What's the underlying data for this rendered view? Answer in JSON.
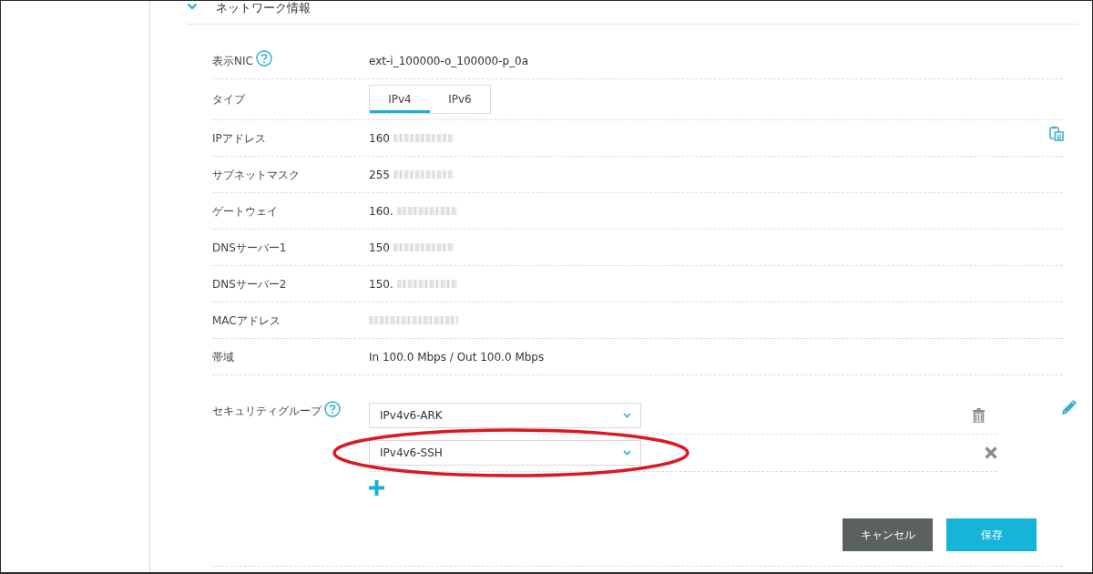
{
  "section": {
    "title": "ネットワーク情報",
    "expanded": true
  },
  "network_info": {
    "rows": [
      {
        "kind": "text",
        "label": "表示NIC",
        "help": true,
        "value": "ext-i_100000-o_100000-p_0a",
        "blurred": false
      },
      {
        "kind": "tabs",
        "label": "タイプ",
        "help": false,
        "tabs": [
          {
            "label": "IPv4",
            "selected": true
          },
          {
            "label": "IPv6",
            "selected": false
          }
        ]
      },
      {
        "kind": "text",
        "label": "IPアドレス",
        "help": false,
        "value": "160",
        "blurred": true
      },
      {
        "kind": "text",
        "label": "サブネットマスク",
        "help": false,
        "value": "255",
        "blurred": true
      },
      {
        "kind": "text",
        "label": "ゲートウェイ",
        "help": false,
        "value": "160.",
        "blurred": true
      },
      {
        "kind": "text",
        "label": "DNSサーバー1",
        "help": false,
        "value": "150",
        "blurred": true
      },
      {
        "kind": "text",
        "label": "DNSサーバー2",
        "help": false,
        "value": "150.",
        "blurred": true
      },
      {
        "kind": "text",
        "label": "MACアドレス",
        "help": false,
        "blurred": true
      },
      {
        "kind": "text",
        "label": "帯域",
        "help": false,
        "value": "In 100.0 Mbps / Out 100.0 Mbps",
        "blurred": false
      }
    ]
  },
  "security_group": {
    "label": "セキュリティグループ",
    "help": true,
    "items": [
      {
        "value": "IPv4v6-ARK",
        "kind": "existing",
        "highlighted": false
      },
      {
        "value": "IPv4v6-SSH",
        "kind": "added",
        "highlighted": true
      }
    ]
  },
  "buttons": [
    {
      "label": "キャンセル",
      "kind": "secondary"
    },
    {
      "label": "保存",
      "kind": "primary"
    }
  ]
}
